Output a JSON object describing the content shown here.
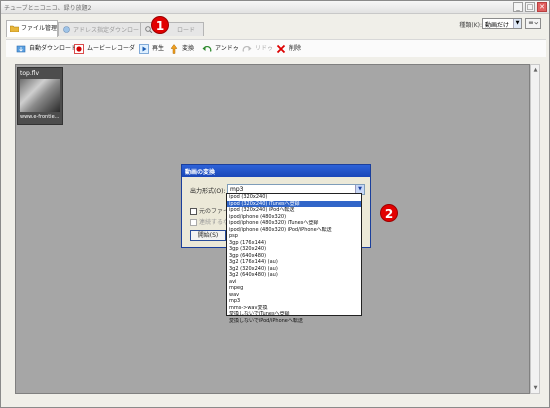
{
  "window": {
    "title": "チューブとニコニコ、録り放題2",
    "min": "_",
    "max": "□",
    "close": "✕"
  },
  "tabs": [
    {
      "label": "ファイル管理"
    },
    {
      "label": "アドレス指定ダウンロード"
    },
    {
      "label": "ロード"
    }
  ],
  "sort": {
    "label": "種類(K):",
    "value": "動画だけ"
  },
  "toolbar": {
    "auto_download": "自動ダウンロード",
    "movie_recorder": "ムービーレコーダ",
    "play": "再生",
    "convert": "変換",
    "undo": "アンドゥ",
    "redo": "リドゥ",
    "delete": "削除"
  },
  "thumbnail": {
    "filename": "top.flv",
    "url": "www.e-frontie..."
  },
  "dialog": {
    "title": "動画の変換",
    "output_label": "出力形式(O):",
    "output_value": "mp3",
    "check_original": "元のファイル",
    "check_continue": "連続するな",
    "start_button": "開始(S)"
  },
  "format_options": [
    "ipod (320x240)",
    "ipod (320x240) iTunesへ登録",
    "ipod (320x240) iPodへ転送",
    "ipod/iphone (480x320)",
    "ipod/iphone (480x320) iTunesへ登録",
    "ipod/iphone (480x320) iPod/iPhoneへ転送",
    "psp",
    "3gp (176x144)",
    "3gp (320x240)",
    "3gp (640x480)",
    "3g2 (176x144) (au)",
    "3g2 (320x240) (au)",
    "3g2 (640x480) (au)",
    "avi",
    "mpeg",
    "wav",
    "mp3",
    "mms->wav変換",
    "変換しないでiTunesへ登録",
    "変換しないでiPod/iPhoneへ転送"
  ],
  "selected_index": 1,
  "badges": {
    "one": "1",
    "two": "2"
  },
  "colors": {
    "badge": "#e20000",
    "selection": "#3165c8",
    "dialog_title": "#1a47b8"
  }
}
